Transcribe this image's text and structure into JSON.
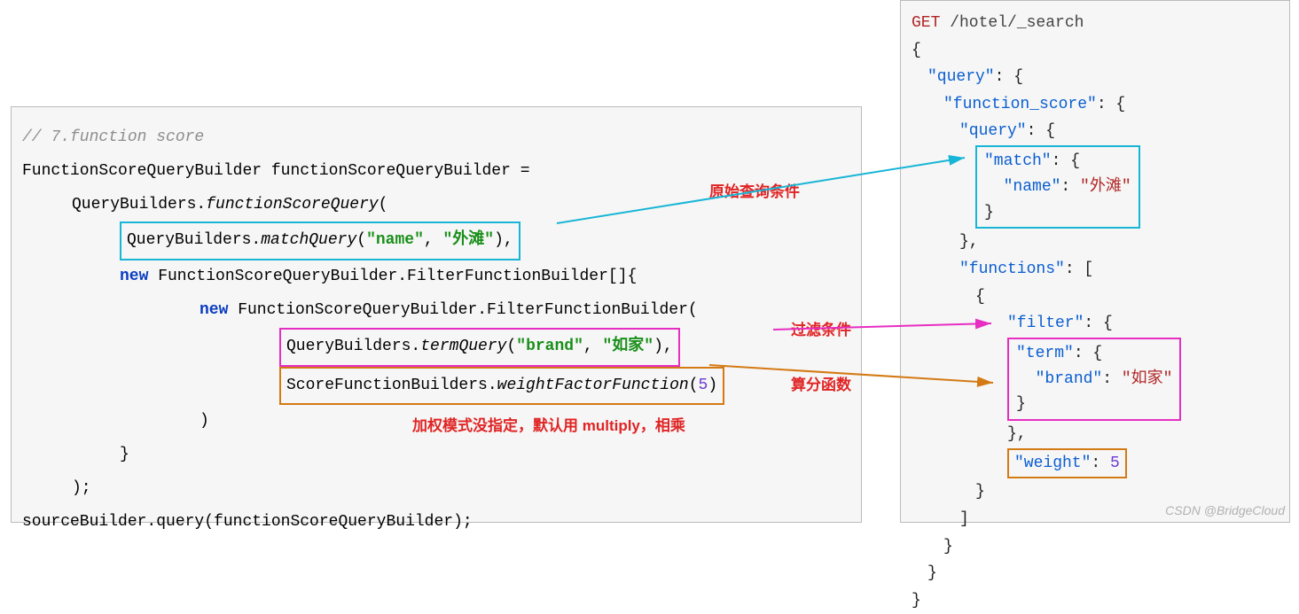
{
  "java": {
    "comment": "// 7.function score",
    "l1": "FunctionScoreQueryBuilder functionScoreQueryBuilder =",
    "l2a": "QueryBuilders.",
    "l2b": "functionScoreQuery",
    "l2c": "(",
    "box1a": "QueryBuilders.",
    "box1b": "matchQuery",
    "box1c": "(",
    "box1d": "\"name\"",
    "box1e": ", ",
    "box1f": "\"外滩\"",
    "box1g": "),",
    "l3a": "new",
    "l3b": " FunctionScoreQueryBuilder.FilterFunctionBuilder[]{",
    "l4a": "new",
    "l4b": " FunctionScoreQueryBuilder.FilterFunctionBuilder(",
    "box2a": "QueryBuilders.",
    "box2b": "termQuery",
    "box2c": "(",
    "box2d": "\"brand\"",
    "box2e": ", ",
    "box2f": "\"如家\"",
    "box2g": "),",
    "box3a": "ScoreFunctionBuilders.",
    "box3b": "weightFactorFunction",
    "box3c": "(",
    "box3d": "5",
    "box3e": ")",
    "closeParen": ")",
    "closeBrace": "}",
    "closeSemi": ");",
    "last": "sourceBuilder.query(functionScoreQueryBuilder);"
  },
  "json": {
    "l1a": "GET",
    "l1b": " /hotel/_search",
    "l2": "{",
    "l3a": "\"query\"",
    "l3b": ": {",
    "l4a": "\"function_score\"",
    "l4b": ": {",
    "l5a": "\"query\"",
    "l5b": ": {",
    "box1a": "\"match\"",
    "box1b": ": {",
    "box1c": "\"name\"",
    "box1d": ": ",
    "box1e": "\"外滩\"",
    "box1f": "}",
    "l6": "},",
    "l7a": "\"functions\"",
    "l7b": ": [",
    "l8": "{",
    "l9a": "\"filter\"",
    "l9b": ": {",
    "box2a": "\"term\"",
    "box2b": ": {",
    "box2c": "\"brand\"",
    "box2d": ": ",
    "box2e": "\"如家\"",
    "box2f": "}",
    "l10": "},",
    "box3a": "\"weight\"",
    "box3b": ": ",
    "box3c": "5",
    "l11": "}",
    "l12": "]",
    "l13": "}",
    "l14": "}",
    "l15": "}"
  },
  "labels": {
    "orig": "原始查询条件",
    "filter": "过滤条件",
    "score": "算分函数",
    "mode": "加权模式没指定，默认用 multiply，相乘"
  },
  "watermark": "CSDN @BridgeCloud",
  "colors": {
    "cyan": "#17b5d6",
    "magenta": "#e62ec2",
    "orange": "#d47a15"
  }
}
